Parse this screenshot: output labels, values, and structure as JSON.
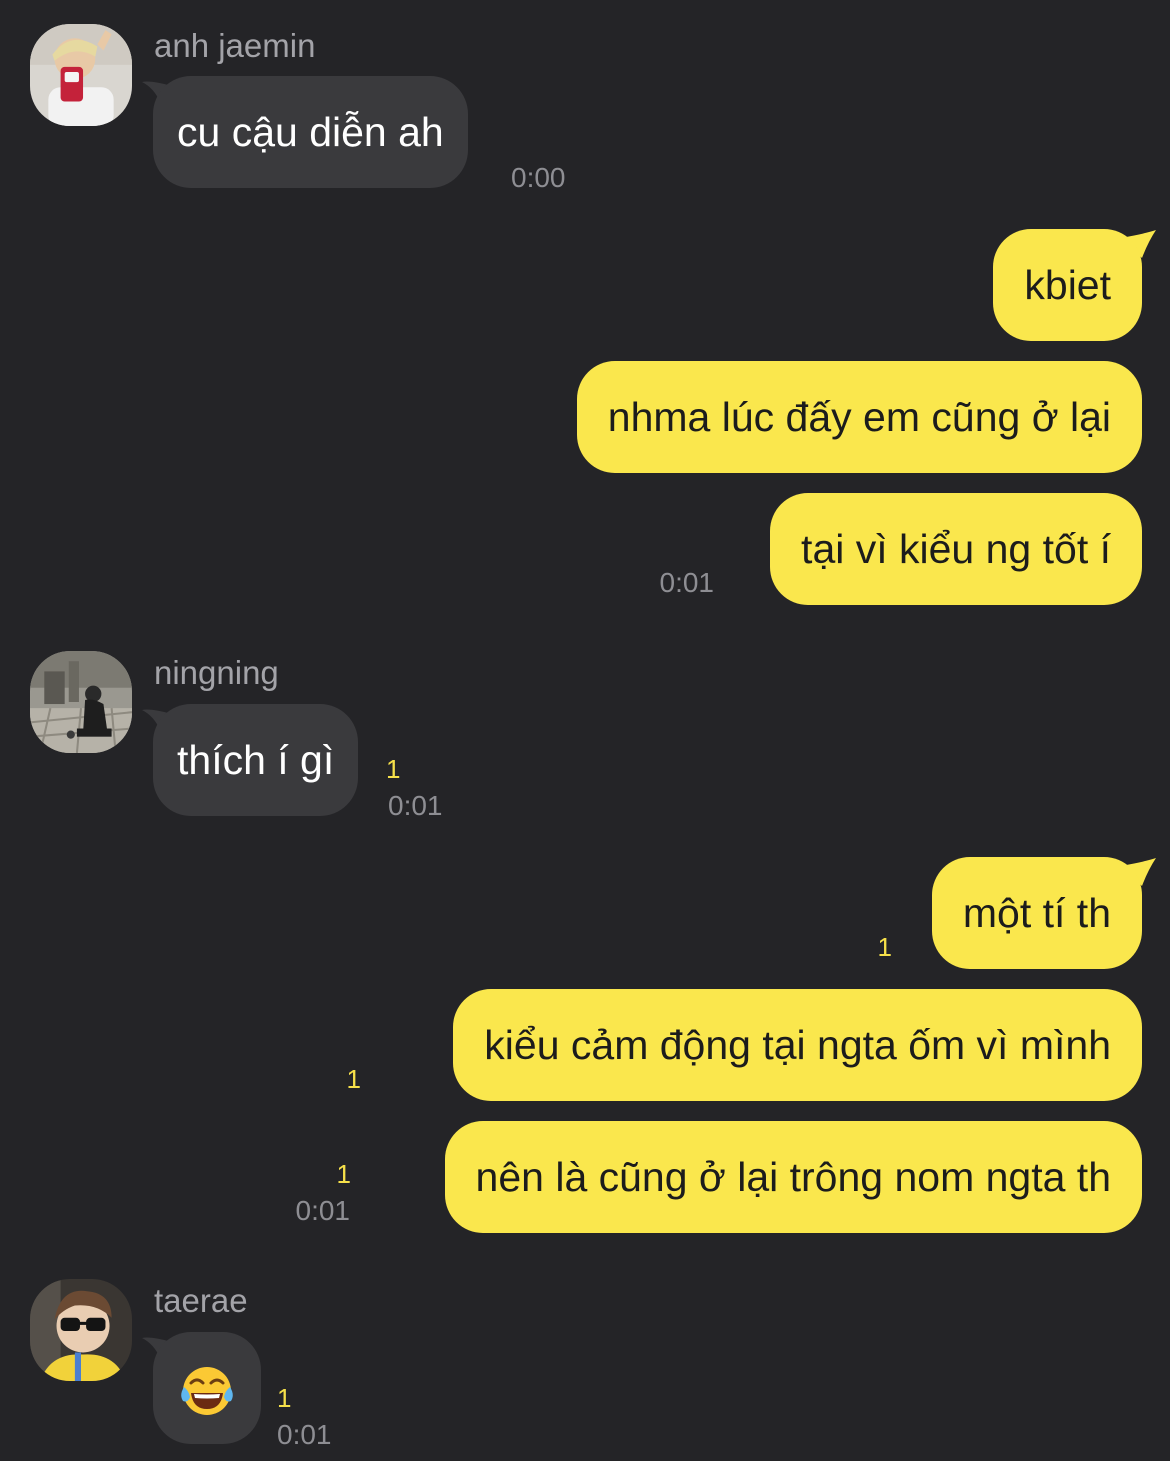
{
  "theme": {
    "background": "#242427",
    "incoming_bubble": "#3a3a3d",
    "outgoing_bubble": "#fae74d",
    "unread_color": "#f6e04a"
  },
  "messages": [
    {
      "sender": "anh jaemin",
      "text": "cu cậu diễn ah",
      "time": "0:00"
    },
    {
      "text": "kbiet"
    },
    {
      "text": "nhma lúc đấy em cũng ở lại"
    },
    {
      "text": "tại vì kiểu ng tốt í",
      "time": "0:01"
    },
    {
      "sender": "ningning",
      "text": "thích í gì",
      "unread": "1",
      "time": "0:01"
    },
    {
      "text": "một tí th",
      "unread": "1"
    },
    {
      "text": "kiểu cảm động tại ngta ốm vì mình",
      "unread": "1"
    },
    {
      "text": "nên là cũng ở lại trông nom ngta th",
      "unread": "1",
      "time": "0:01"
    },
    {
      "sender": "taerae",
      "emoji": "face-with-tears-of-joy",
      "unread": "1",
      "time": "0:01"
    }
  ]
}
